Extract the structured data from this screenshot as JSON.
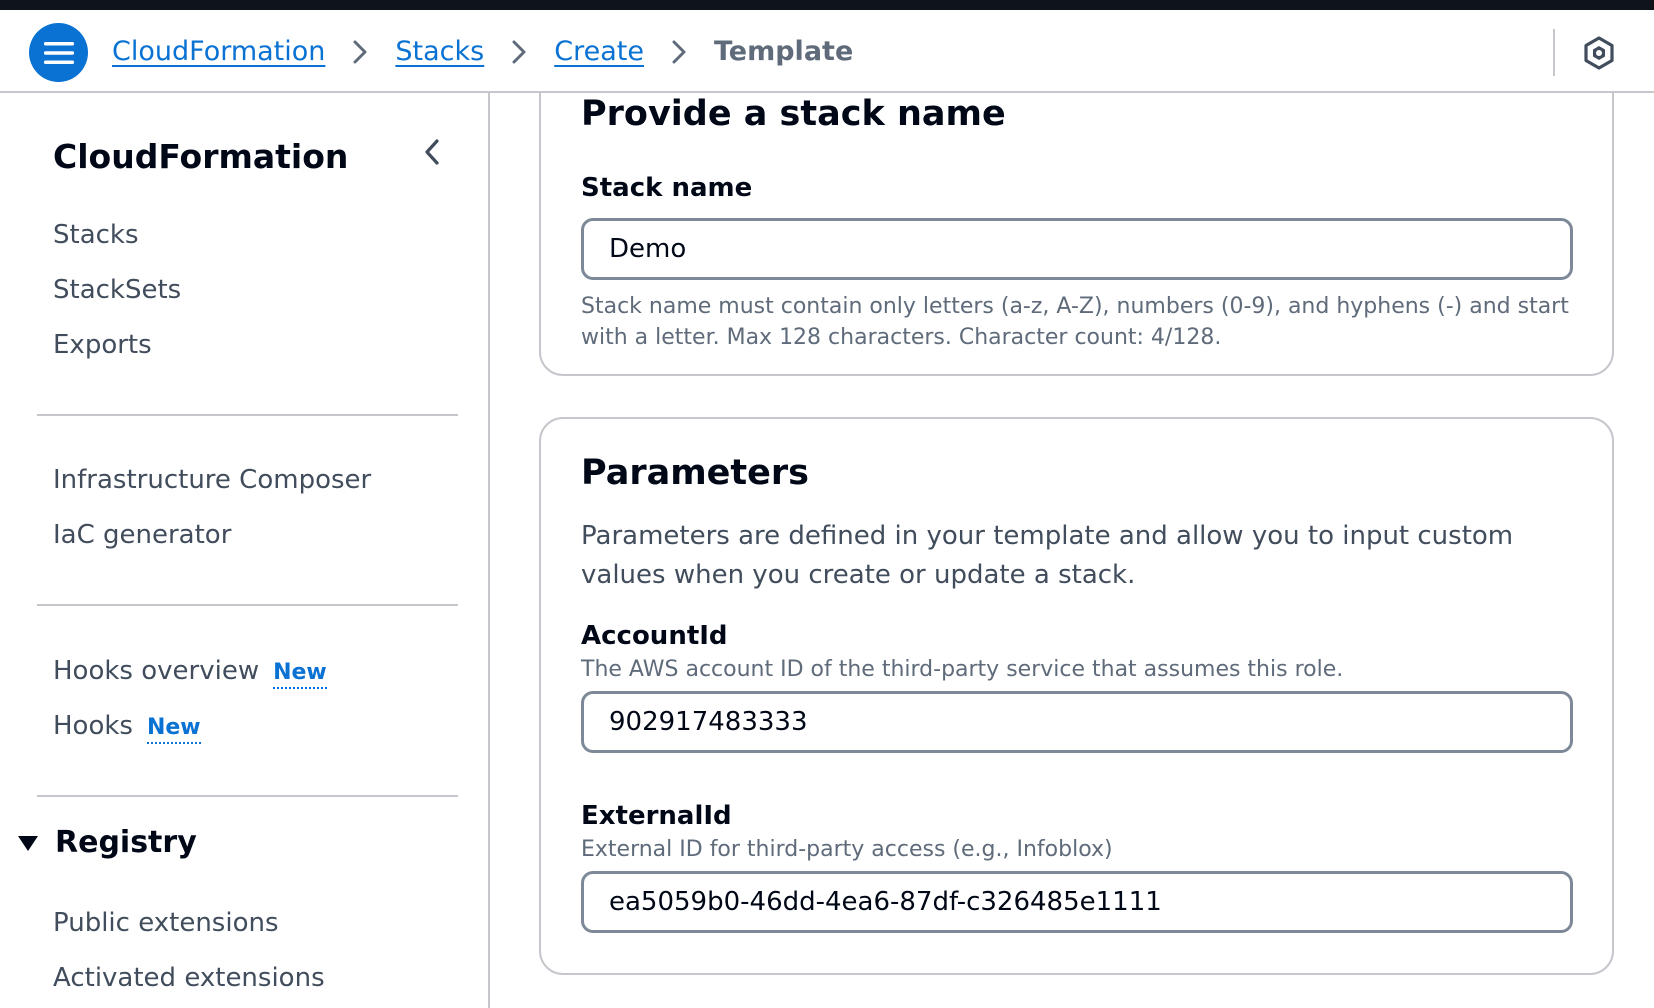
{
  "colors": {
    "primary": "#0972d3",
    "top_strip": "#0f141a",
    "border": "#c6c6cd",
    "input_border": "#7d8998"
  },
  "topbar": {
    "menu_icon": "hamburger-menu-icon",
    "breadcrumbs": [
      {
        "label": "CloudFormation",
        "link": true
      },
      {
        "label": "Stacks",
        "link": true
      },
      {
        "label": "Create",
        "link": true
      },
      {
        "label": "Template",
        "link": false
      }
    ],
    "separator_icon": "chevron-right-icon",
    "right_icon": "settings-hexagon-icon"
  },
  "sidebar": {
    "title": "CloudFormation",
    "collapse_icon": "chevron-left-icon",
    "group1": [
      {
        "label": "Stacks"
      },
      {
        "label": "StackSets"
      },
      {
        "label": "Exports"
      }
    ],
    "group2": [
      {
        "label": "Infrastructure Composer"
      },
      {
        "label": "IaC generator"
      }
    ],
    "group3": [
      {
        "label": "Hooks overview",
        "badge": "New"
      },
      {
        "label": "Hooks",
        "badge": "New"
      }
    ],
    "registry": {
      "label": "Registry",
      "icon": "caret-down-icon",
      "items": [
        {
          "label": "Public extensions"
        },
        {
          "label": "Activated extensions"
        }
      ]
    }
  },
  "stack_name_section": {
    "title": "Provide a stack name",
    "field_label": "Stack name",
    "value": "Demo",
    "constraint": "Stack name must contain only letters (a-z, A-Z), numbers (0-9), and hyphens (-) and start with a letter. Max 128 characters. Character count: 4/128."
  },
  "parameters_section": {
    "title": "Parameters",
    "description": "Parameters are defined in your template and allow you to input custom values when you create or update a stack.",
    "fields": [
      {
        "label": "AccountId",
        "description": "The AWS account ID of the third-party service that assumes this role.",
        "value": "902917483333"
      },
      {
        "label": "ExternalId",
        "description": "External ID for third-party access (e.g., Infoblox)",
        "value": "ea5059b0-46dd-4ea6-87df-c326485e1111"
      }
    ]
  }
}
